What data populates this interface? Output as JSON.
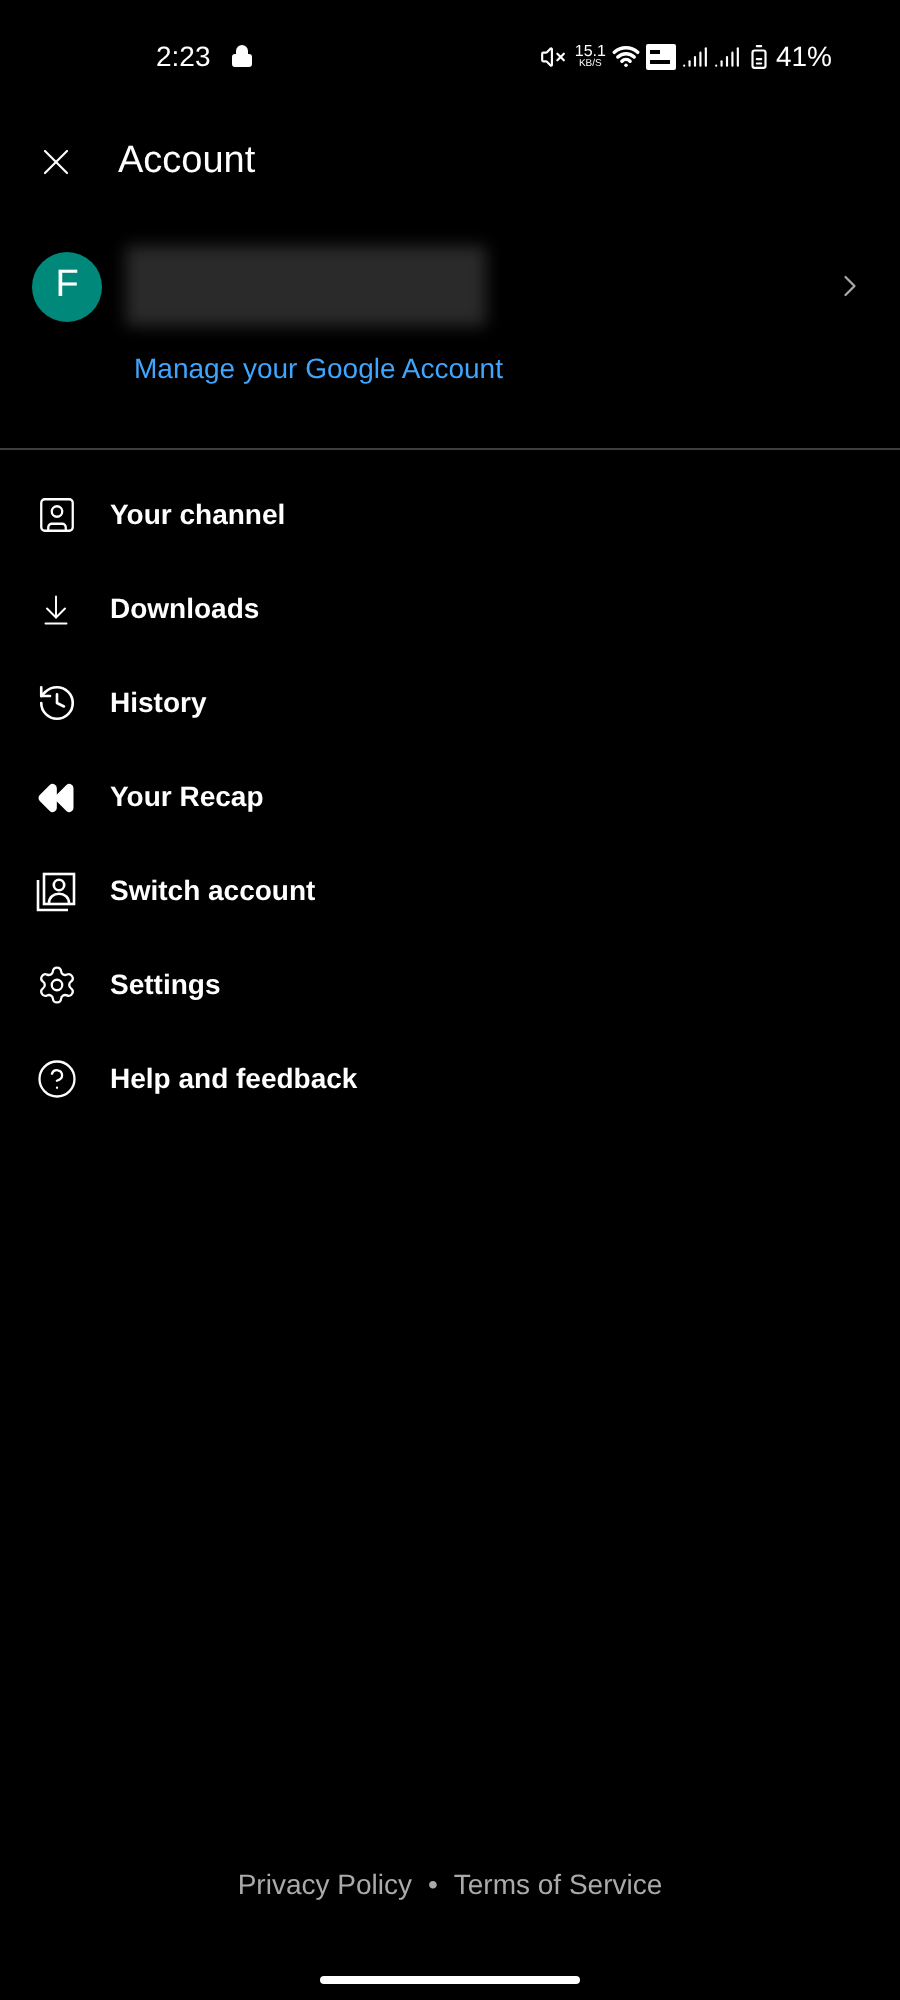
{
  "status_bar": {
    "time": "2:23",
    "speed_value": "15.1",
    "speed_unit": "KB/S",
    "battery": "41%"
  },
  "header": {
    "title": "Account"
  },
  "profile": {
    "avatar_letter": "F",
    "manage_link": "Manage your Google Account"
  },
  "menu": [
    {
      "kind": "channel",
      "label": "Your channel"
    },
    {
      "kind": "downloads",
      "label": "Downloads"
    },
    {
      "kind": "history",
      "label": "History"
    },
    {
      "kind": "recap",
      "label": "Your Recap"
    },
    {
      "kind": "switch",
      "label": "Switch account"
    },
    {
      "kind": "settings",
      "label": "Settings"
    },
    {
      "kind": "help",
      "label": "Help and feedback"
    }
  ],
  "footer": {
    "links": [
      "Privacy Policy",
      "Terms of Service"
    ],
    "separator": "•"
  }
}
